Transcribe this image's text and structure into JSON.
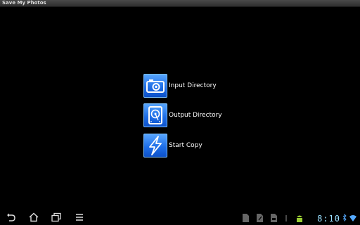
{
  "app": {
    "title": "Save My Photos"
  },
  "menu": [
    {
      "label": "Input Directory",
      "icon": "camera-icon"
    },
    {
      "label": "Output Directory",
      "icon": "hard-drive-icon"
    },
    {
      "label": "Start Copy",
      "icon": "lightning-icon"
    }
  ],
  "statusbar": {
    "time": "8:10"
  },
  "colors": {
    "accent": "#1f6fe8",
    "clock": "#9adfff"
  }
}
